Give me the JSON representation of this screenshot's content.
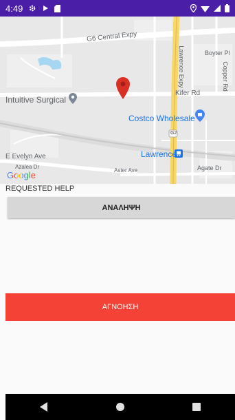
{
  "status_bar": {
    "time": "4:49",
    "icons": [
      "gear-icon",
      "play-icon",
      "sd-card-icon",
      "location-icon",
      "wifi-icon",
      "signal-icon",
      "battery-icon"
    ]
  },
  "map": {
    "labels": {
      "g6": "G6 Central Expy",
      "lawrence_expy": "Lawrence Expy",
      "boyter": "Boyter Pl",
      "copper": "Copper Rd",
      "intuitive": "Intuitive Surgical",
      "kifer": "Kifer Rd",
      "costco": "Costco Wholesale",
      "g2": "G2",
      "e_evelyn": "E Evelyn Ave",
      "lawrence": "Lawrence",
      "azalea": "Azalea Dr",
      "aster": "Aster Ave",
      "agate": "Agate Dr",
      "google": "Google"
    },
    "colors": {
      "marker": "#d93025",
      "expressway": "#f7d768",
      "transit_blue": "#1a73e8"
    }
  },
  "section": {
    "title": "REQUESTED HELP"
  },
  "buttons": {
    "analipsi": "ΑΝΑΛΗΨΗ",
    "agnoisi": "ΑΓΝΟΗΣΗ"
  },
  "colors": {
    "statusbar": "#4a1ea6",
    "reject_button": "#f44336",
    "accept_button": "#d7d7d7"
  }
}
